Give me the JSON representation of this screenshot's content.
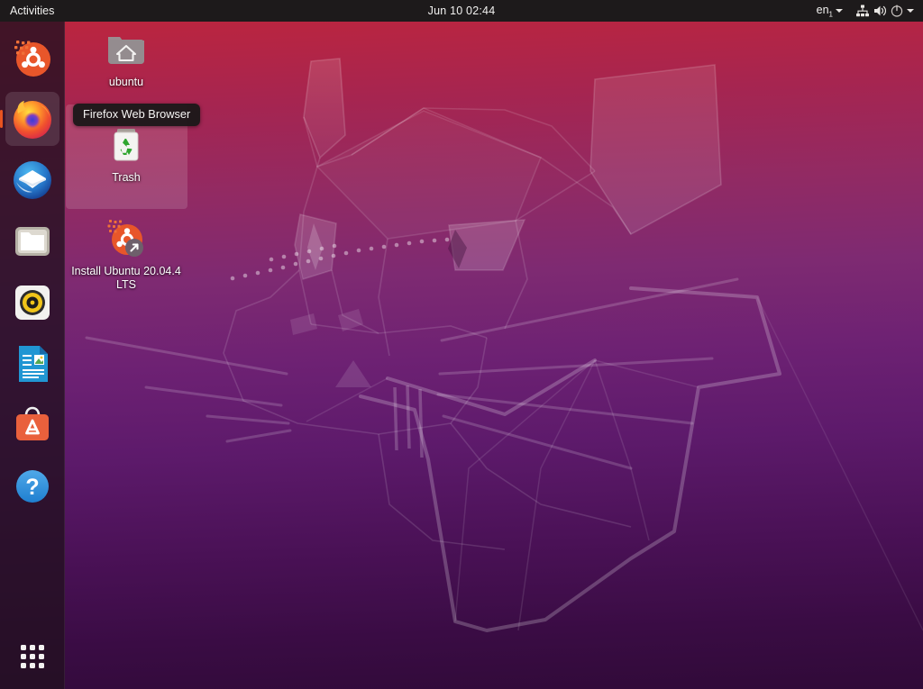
{
  "topbar": {
    "activities_label": "Activities",
    "clock": "Jun 10  02:44",
    "language": "en",
    "language_sub": "1",
    "icons": {
      "language_caret": "chevron-down-icon",
      "network": "network-icon",
      "volume": "volume-icon",
      "power": "power-icon",
      "system_caret": "chevron-down-icon"
    }
  },
  "dock": {
    "items": [
      {
        "name": "ubuntu-software-logo",
        "label": "Ubuntu",
        "active": false
      },
      {
        "name": "firefox",
        "label": "Firefox Web Browser",
        "active": true
      },
      {
        "name": "thunderbird",
        "label": "Thunderbird Mail",
        "active": false
      },
      {
        "name": "files",
        "label": "Files",
        "active": false
      },
      {
        "name": "rhythmbox",
        "label": "Rhythmbox",
        "active": false
      },
      {
        "name": "libreoffice-writer",
        "label": "LibreOffice Writer",
        "active": false
      },
      {
        "name": "ubuntu-software",
        "label": "Ubuntu Software",
        "active": false
      },
      {
        "name": "help",
        "label": "Help",
        "active": false
      }
    ],
    "show_applications_label": "Show Applications"
  },
  "desktop": {
    "icons": [
      {
        "name": "home-folder",
        "label": "ubuntu"
      },
      {
        "name": "trash",
        "label": "Trash"
      },
      {
        "name": "install-ubuntu",
        "label": "Install Ubuntu 20.04.4 LTS"
      }
    ]
  },
  "tooltip": {
    "text": "Firefox Web Browser"
  },
  "colors": {
    "accent": "#e95420",
    "topbar_bg": "#1d1a1b",
    "dock_bg": "rgba(35,16,32,0.80)",
    "wallpaper_top": "#c0253a",
    "wallpaper_bottom": "#300a38"
  }
}
